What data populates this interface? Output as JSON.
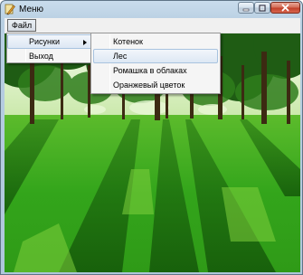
{
  "window": {
    "title": "Меню",
    "icon": "pencil-app-icon"
  },
  "menubar": {
    "items": [
      {
        "label": "Файл"
      }
    ]
  },
  "file_menu": {
    "items": [
      {
        "label": "Рисунки",
        "has_submenu": true
      },
      {
        "label": "Выход"
      }
    ]
  },
  "pictures_submenu": {
    "items": [
      {
        "label": "Котенок"
      },
      {
        "label": "Лес",
        "highlighted": true
      },
      {
        "label": "Ромашка в облаках"
      },
      {
        "label": "Оранжевый цветок"
      }
    ]
  },
  "colors": {
    "grass": "#33a51b",
    "foliage": "#1f5c14",
    "sky": "#e8f5d8",
    "highlight_border": "#a8c3df"
  }
}
